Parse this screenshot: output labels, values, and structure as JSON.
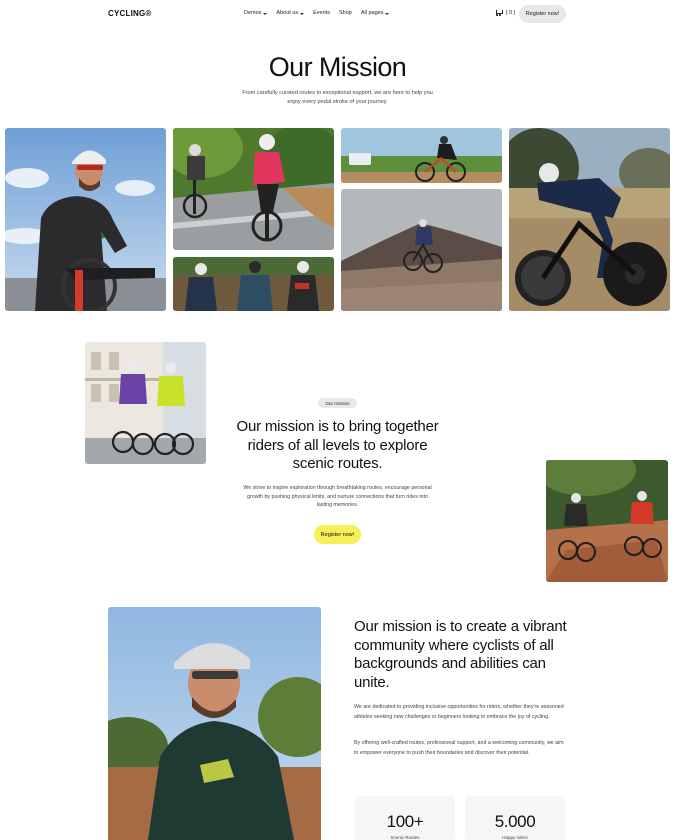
{
  "header": {
    "logo": "CYCLING®",
    "nav": [
      {
        "label": "Demos",
        "dropdown": true
      },
      {
        "label": "About us",
        "dropdown": true
      },
      {
        "label": "Events",
        "dropdown": false
      },
      {
        "label": "Shop",
        "dropdown": false
      },
      {
        "label": "All pages",
        "dropdown": true
      }
    ],
    "cart_count": "[ 0 ]",
    "register_label": "Register now!"
  },
  "hero": {
    "title": "Our Mission",
    "subtitle": "From carefully curated routes to exceptional support, we are here to help you enjoy every pedal stroke of your journey."
  },
  "mission": {
    "badge": "Our mission",
    "title": "Our mission is to bring together riders of all levels to explore scenic routes.",
    "text": "We strive to inspire exploration through breathtaking routes, encourage personal growth by pushing physical limits, and nurture connections that turn rides into lasting memories.",
    "register_label": "Register now!"
  },
  "community": {
    "title": "Our mission is to create a vibrant community where cyclists of all backgrounds and abilities can unite.",
    "text1": "We are dedicated to providing inclusive opportunities for riders, whether they're seasoned athletes seeking new challenges or beginners looking to embrace the joy of cycling.",
    "text2": "By offering well-crafted routes, professional support, and a welcoming community, we aim to empower everyone to push their boundaries and discover their potential.",
    "stats": [
      {
        "value": "100+",
        "label": "Scenic Routes"
      },
      {
        "value": "5.000",
        "label": "Happy riders"
      }
    ]
  },
  "colors": {
    "accent_yellow": "#f7ef5a",
    "button_grey": "#e8e8e8",
    "text_dark": "#111111"
  }
}
